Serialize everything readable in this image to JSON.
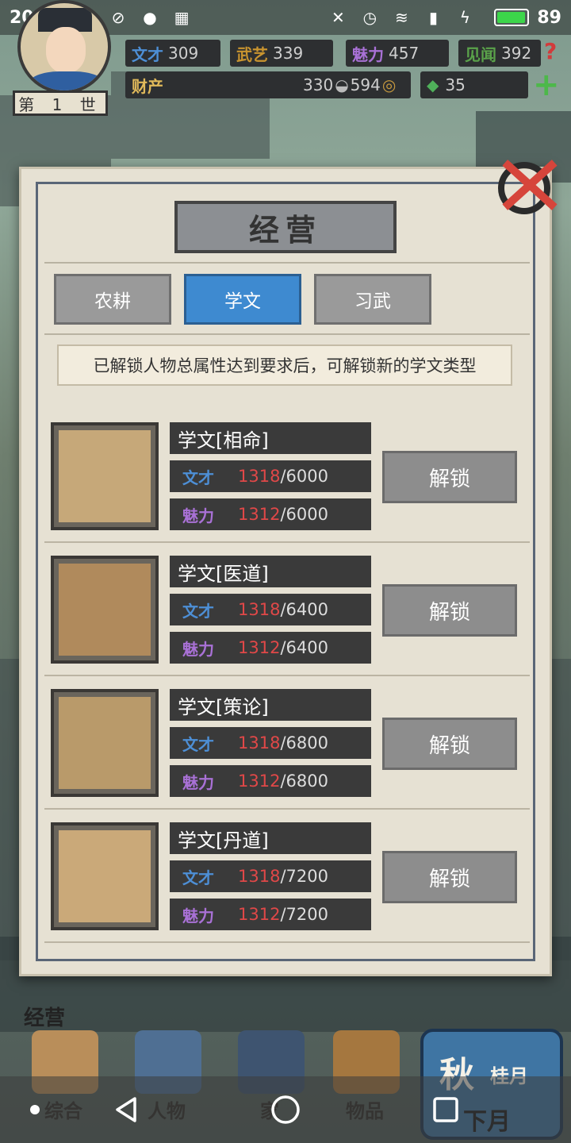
{
  "status_bar": {
    "time": "20:29",
    "battery": "89"
  },
  "header": {
    "generation": "第 1 世",
    "stats": [
      {
        "label": "文才",
        "value": "309",
        "color": "#4d8fd6"
      },
      {
        "label": "武艺",
        "value": "339",
        "color": "#c9942f"
      },
      {
        "label": "魅力",
        "value": "457",
        "color": "#a971d6"
      },
      {
        "label": "见闻",
        "value": "392",
        "color": "#5aa24a"
      }
    ],
    "wealth_label": "财产",
    "silver": "330",
    "copper": "594",
    "jade": "35"
  },
  "modal": {
    "title": "经营",
    "tabs": [
      {
        "label": "农耕",
        "active": false
      },
      {
        "label": "学文",
        "active": true
      },
      {
        "label": "习武",
        "active": false
      }
    ],
    "notice": "已解锁人物总属性达到要求后，可解锁新的学文类型",
    "items": [
      {
        "name": "学文[相命]",
        "icon": "fortune-scroll-icon",
        "req1": {
          "attr": "文才",
          "cur": "1318",
          "need": "/6000"
        },
        "req2": {
          "attr": "魅力",
          "cur": "1312",
          "need": "/6000"
        },
        "button": "解锁"
      },
      {
        "name": "学文[医道]",
        "icon": "medicine-icon",
        "req1": {
          "attr": "文才",
          "cur": "1318",
          "need": "/6400"
        },
        "req2": {
          "attr": "魅力",
          "cur": "1312",
          "need": "/6400"
        },
        "button": "解锁"
      },
      {
        "name": "学文[策论]",
        "icon": "brush-paper-icon",
        "req1": {
          "attr": "文才",
          "cur": "1318",
          "need": "/6800"
        },
        "req2": {
          "attr": "魅力",
          "cur": "1312",
          "need": "/6800"
        },
        "button": "解锁"
      },
      {
        "name": "学文[丹道]",
        "icon": "landscape-scroll-icon",
        "req1": {
          "attr": "文才",
          "cur": "1318",
          "need": "/7200"
        },
        "req2": {
          "attr": "魅力",
          "cur": "1312",
          "need": "/7200"
        },
        "button": "解锁"
      }
    ]
  },
  "bottom": {
    "section_label": "经营",
    "nav": [
      {
        "label": "综合",
        "icon": "overview-icon"
      },
      {
        "label": "人物",
        "icon": "character-icon"
      },
      {
        "label": "家",
        "icon": "home-icon"
      },
      {
        "label": "物品",
        "icon": "items-icon"
      }
    ],
    "season": "秋",
    "month": "桂月",
    "next_month": "下月"
  }
}
